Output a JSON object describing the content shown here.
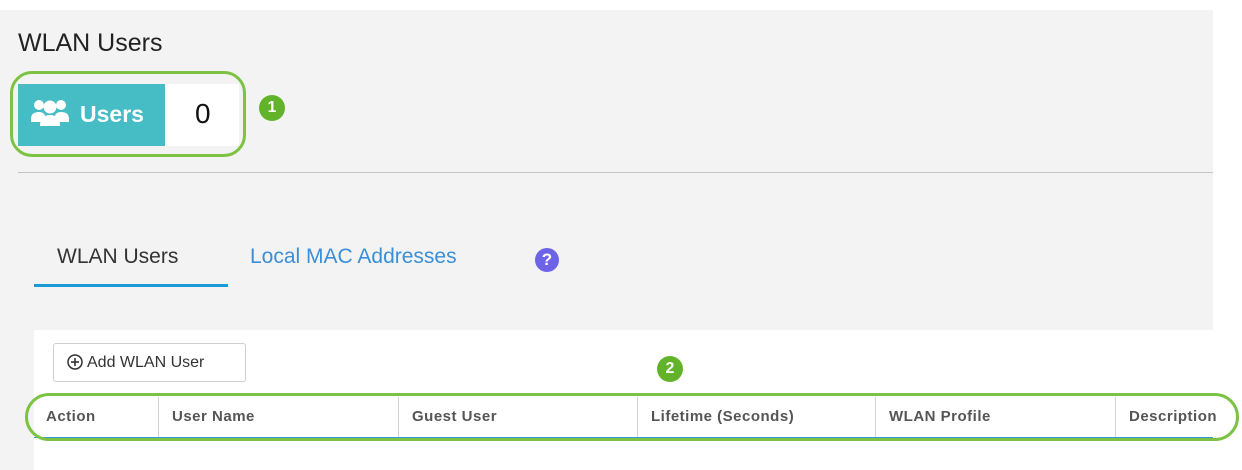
{
  "page": {
    "title": "WLAN Users"
  },
  "users_card": {
    "icon": "users-icon",
    "label": "Users",
    "count": "0"
  },
  "callouts": [
    {
      "label": "1"
    },
    {
      "label": "2"
    }
  ],
  "tabs": [
    {
      "label": "WLAN Users",
      "active": true
    },
    {
      "label": "Local MAC Addresses",
      "active": false
    }
  ],
  "help": {
    "icon": "question-circle-icon",
    "glyph": "?"
  },
  "toolbar": {
    "add_icon": "plus-circle-icon",
    "add_label": "Add WLAN User"
  },
  "table": {
    "columns": [
      "Action",
      "User Name",
      "Guest User",
      "Lifetime (Seconds)",
      "WLAN Profile",
      "Description"
    ]
  },
  "colors": {
    "accent_teal": "#46bcc4",
    "callout_green": "#7dc242",
    "tab_blue": "#3a8fd6",
    "help_purple": "#6c63e6"
  }
}
